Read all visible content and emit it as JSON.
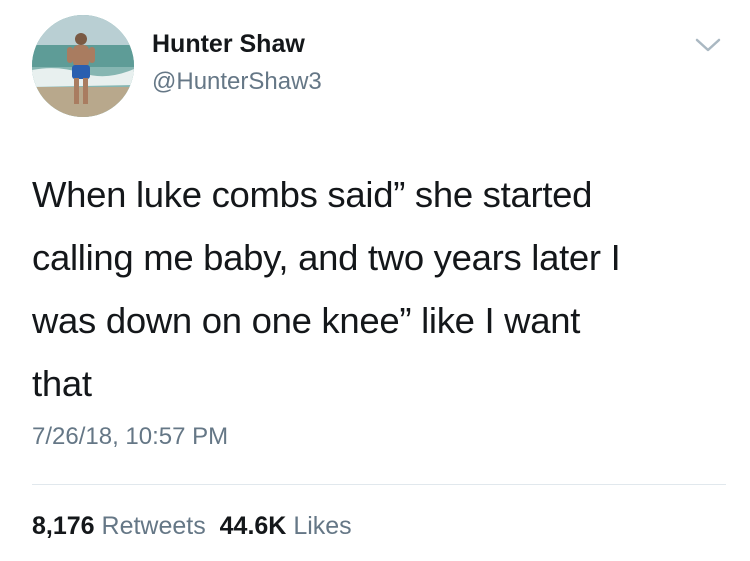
{
  "author": {
    "display_name": "Hunter Shaw",
    "handle": "@HunterShaw3",
    "avatar_icon": "profile-photo"
  },
  "tweet": {
    "text_lines": [
      "When luke combs said” she started",
      "calling me baby, and two years later I",
      "was down on one knee” like I want",
      "that"
    ],
    "timestamp": "7/26/18, 10:57 PM"
  },
  "stats": {
    "retweets_count": "8,176",
    "retweets_label": "Retweets",
    "likes_count": "44.6K",
    "likes_label": "Likes"
  },
  "menu": {
    "icon": "chevron-down-icon"
  },
  "colors": {
    "primary_text": "#14171a",
    "secondary_text": "#657786",
    "divider": "#e1e8ed"
  }
}
